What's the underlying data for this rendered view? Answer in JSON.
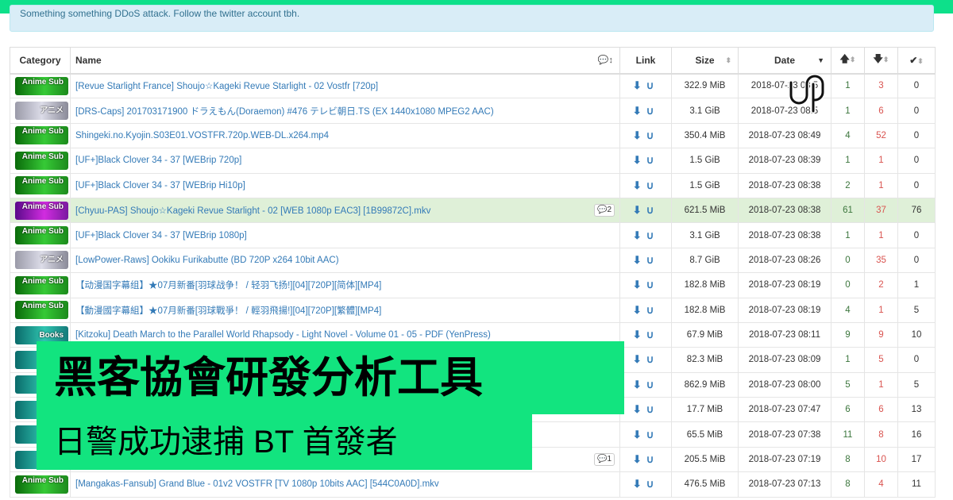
{
  "alert": "Something something DDoS attack. Follow the twitter account tbh.",
  "columns": {
    "category": "Category",
    "name": "Name",
    "link": "Link",
    "size": "Size",
    "date": "Date"
  },
  "rows": [
    {
      "cat": "anime",
      "cat_label": "Anime Sub",
      "name": "[Revue Starlight France] Shoujo☆Kageki Revue Starlight - 02 Vostfr [720p]",
      "comments": "",
      "size": "322.9 MiB",
      "date": "2018-07-23 08:5",
      "seed": "1",
      "leech": "3",
      "done": "0"
    },
    {
      "cat": "raw",
      "cat_label": "アニメ",
      "name": "[DRS-Caps] 201703171900 ドラえもん(Doraemon) #476 テレビ朝日.TS (EX 1440x1080 MPEG2 AAC)",
      "comments": "",
      "size": "3.1 GiB",
      "date": "2018-07-23 08:5",
      "seed": "1",
      "leech": "6",
      "done": "0"
    },
    {
      "cat": "anime",
      "cat_label": "Anime Sub",
      "name": "Shingeki.no.Kyojin.S03E01.VOSTFR.720p.WEB-DL.x264.mp4",
      "comments": "",
      "size": "350.4 MiB",
      "date": "2018-07-23 08:49",
      "seed": "4",
      "leech": "52",
      "done": "0"
    },
    {
      "cat": "anime",
      "cat_label": "Anime Sub",
      "name": "[UF+]Black Clover 34 - 37 [WEBrip 720p]",
      "comments": "",
      "size": "1.5 GiB",
      "date": "2018-07-23 08:39",
      "seed": "1",
      "leech": "1",
      "done": "0"
    },
    {
      "cat": "anime",
      "cat_label": "Anime Sub",
      "name": "[UF+]Black Clover 34 - 37 [WEBrip Hi10p]",
      "comments": "",
      "size": "1.5 GiB",
      "date": "2018-07-23 08:38",
      "seed": "2",
      "leech": "1",
      "done": "0"
    },
    {
      "cat": "purple",
      "cat_label": "Anime Sub",
      "name": "[Chyuu-PAS] Shoujo☆Kageki Revue Starlight - 02 [WEB 1080p EAC3] [1B99872C].mkv",
      "comments": "2",
      "size": "621.5 MiB",
      "date": "2018-07-23 08:38",
      "seed": "61",
      "leech": "37",
      "done": "76",
      "green": true
    },
    {
      "cat": "anime",
      "cat_label": "Anime Sub",
      "name": "[UF+]Black Clover 34 - 37 [WEBrip 1080p]",
      "comments": "",
      "size": "3.1 GiB",
      "date": "2018-07-23 08:38",
      "seed": "1",
      "leech": "1",
      "done": "0"
    },
    {
      "cat": "raw",
      "cat_label": "アニメ",
      "name": "[LowPower-Raws] Ookiku Furikabutte (BD 720P x264 10bit AAC)",
      "comments": "",
      "size": "8.7 GiB",
      "date": "2018-07-23 08:26",
      "seed": "0",
      "leech": "35",
      "done": "0"
    },
    {
      "cat": "anime",
      "cat_label": "Anime Sub",
      "name": "【动漫国字幕组】★07月新番[羽球战争！ / 轻羽飞扬!][04][720P][简体][MP4]",
      "comments": "",
      "size": "182.8 MiB",
      "date": "2018-07-23 08:19",
      "seed": "0",
      "leech": "2",
      "done": "1"
    },
    {
      "cat": "anime",
      "cat_label": "Anime Sub",
      "name": "【動漫國字幕組】★07月新番[羽球戰爭！ / 輕羽飛揚!][04][720P][繁體][MP4]",
      "comments": "",
      "size": "182.8 MiB",
      "date": "2018-07-23 08:19",
      "seed": "4",
      "leech": "1",
      "done": "5"
    },
    {
      "cat": "books",
      "cat_label": "Books",
      "name": "[Kitzoku] Death March to the Parallel World Rhapsody - Light Novel - Volume 01 - 05 - PDF (YenPress)",
      "comments": "",
      "size": "67.9 MiB",
      "date": "2018-07-23 08:11",
      "seed": "9",
      "leech": "9",
      "done": "10"
    },
    {
      "cat": "books",
      "cat_label": "",
      "name": "",
      "comments": "",
      "size": "82.3 MiB",
      "date": "2018-07-23 08:09",
      "seed": "1",
      "leech": "5",
      "done": "0"
    },
    {
      "cat": "books",
      "cat_label": "",
      "name": "",
      "comments": "",
      "size": "862.9 MiB",
      "date": "2018-07-23 08:00",
      "seed": "5",
      "leech": "1",
      "done": "5"
    },
    {
      "cat": "books",
      "cat_label": "",
      "name": "",
      "comments": "",
      "size": "17.7 MiB",
      "date": "2018-07-23 07:47",
      "seed": "6",
      "leech": "6",
      "done": "13"
    },
    {
      "cat": "books",
      "cat_label": "",
      "name": "",
      "comments": "",
      "size": "65.5 MiB",
      "date": "2018-07-23 07:38",
      "seed": "11",
      "leech": "8",
      "done": "16"
    },
    {
      "cat": "books",
      "cat_label": "",
      "name": "",
      "comments": "1",
      "size": "205.5 MiB",
      "date": "2018-07-23 07:19",
      "seed": "8",
      "leech": "10",
      "done": "17"
    },
    {
      "cat": "anime",
      "cat_label": "Anime Sub",
      "name": "[Mangakas-Fansub] Grand Blue - 01v2 VOSTFR [TV 1080p 10bits AAC] [544C0A0D].mkv",
      "comments": "",
      "size": "476.5 MiB",
      "date": "2018-07-23 07:13",
      "seed": "8",
      "leech": "4",
      "done": "11"
    }
  ],
  "overlay": {
    "title": "黑客協會研發分析工具",
    "subtitle": "日警成功逮捕 BT 首發者"
  },
  "colors": {
    "accent": "#12e47f",
    "link": "#337ab7",
    "seeders": "#3c763d",
    "leechers": "#d9534f"
  }
}
